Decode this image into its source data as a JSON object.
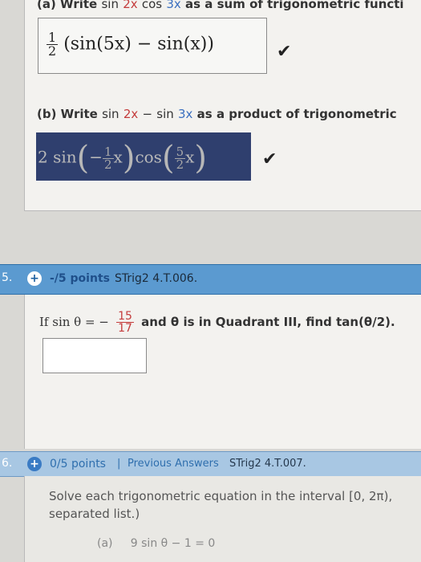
{
  "part_a": {
    "label": "(a) Write",
    "expr1": "sin",
    "expr2": "2x",
    "expr3": "cos",
    "expr4": "3x",
    "tail": "as a sum of trigonometric functi",
    "answer": {
      "coef_num": "1",
      "coef_den": "2",
      "body": "(sin(5x) − sin(x))"
    }
  },
  "part_b": {
    "label": "(b) Write",
    "expr1": "sin",
    "expr2": "2x",
    "minus": "−",
    "expr3": "sin",
    "expr4": "3x",
    "tail": "as a product of trigonometric",
    "answer": {
      "lead": "2 sin",
      "f1_sign": "−",
      "f1_num": "1",
      "f1_den": "2",
      "x1": "x",
      "cos": "cos",
      "f2_num": "5",
      "f2_den": "2",
      "x2": "x"
    }
  },
  "q5": {
    "number": "5.",
    "points": "-/5 points",
    "code": "STrig2 4.T.006.",
    "prompt_start": "If sin θ = −",
    "frac_num": "15",
    "frac_den": "17",
    "prompt_end": "and θ is in Quadrant III, find tan(θ/2)."
  },
  "q6": {
    "number": "6.",
    "points": "0/5 points",
    "separator": "|",
    "prev_answers": "Previous Answers",
    "code": "STrig2 4.T.007.",
    "line1": "Solve each trigonometric equation in the interval [0, 2π),",
    "line2": "separated list.)",
    "part_a_label": "(a)",
    "part_a_expr": "9 sin θ − 1 = 0"
  },
  "colors": {
    "header_active": "#5b9ad0",
    "header_inactive": "#a8c7e3",
    "answer_highlight": "#2f3f6e",
    "accent_red": "#c43c3c",
    "accent_blue": "#3b6fbf"
  },
  "icons": {
    "check": "check-icon",
    "plus": "plus-circle-icon"
  }
}
